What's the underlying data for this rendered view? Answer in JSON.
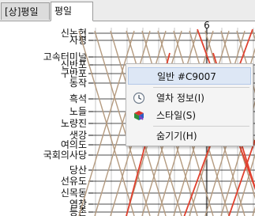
{
  "tabs": [
    {
      "label": "[상]평일",
      "active": false
    },
    {
      "label": "평일",
      "active": true
    }
  ],
  "diagram": {
    "time_label": "6",
    "stations": [
      "신논현",
      "사평",
      "고속터미널",
      "신반포",
      "구반포",
      "동작",
      "흑석",
      "노들",
      "노량진",
      "샛강",
      "여의도",
      "국회의사당",
      "당산",
      "선유도",
      "신목동",
      "염창",
      "등촌"
    ],
    "colors": {
      "express": "#e0412e",
      "local": "#b59b80",
      "grid": "#c8c8c8",
      "hour_line": "#111111"
    }
  },
  "context_menu": {
    "items": [
      {
        "label": "일반 #C9007",
        "icon": "none",
        "highlighted": true
      },
      {
        "label": "열차 정보(I)",
        "icon": "clock-icon",
        "highlighted": false
      },
      {
        "label": "스타일(S)",
        "icon": "palette-icon",
        "highlighted": false
      },
      {
        "label": "숨기기(H)",
        "icon": "none",
        "highlighted": false
      }
    ]
  }
}
